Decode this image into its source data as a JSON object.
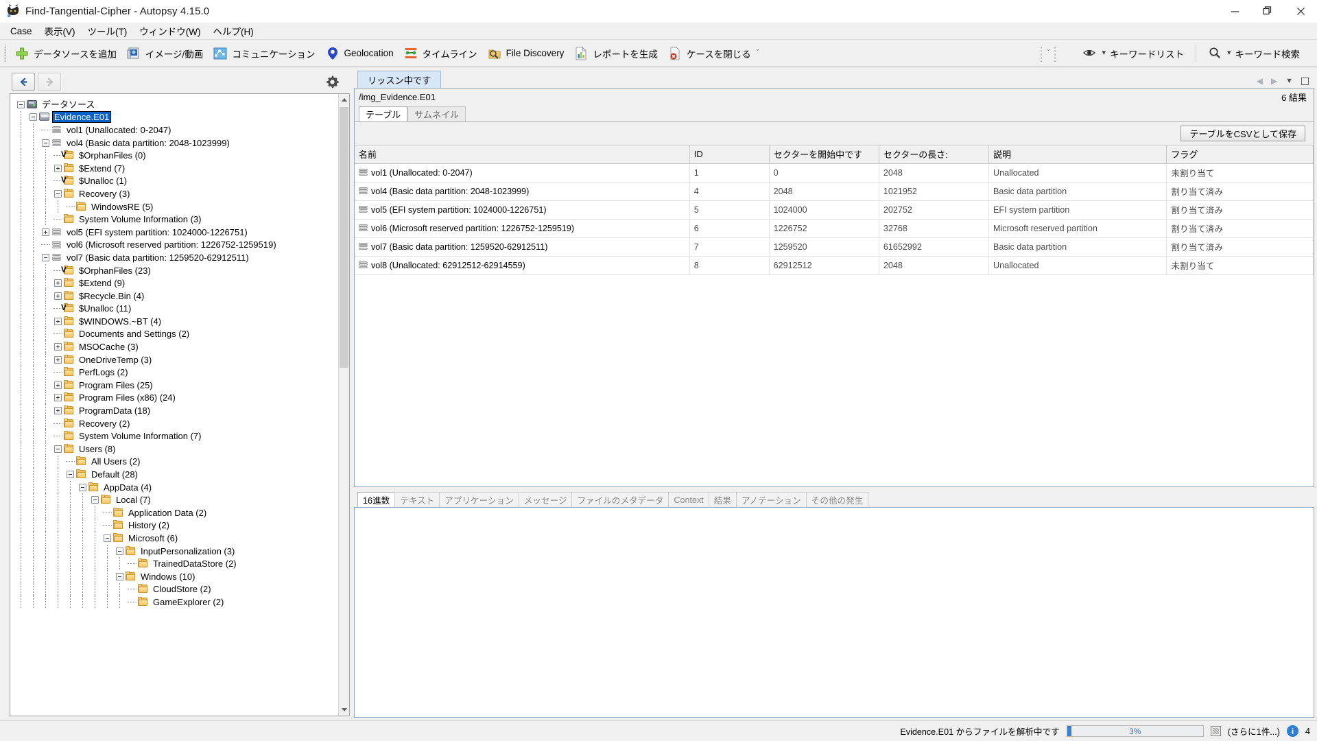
{
  "window": {
    "title": "Find-Tangential-Cipher - Autopsy 4.15.0",
    "app_icon": "autopsy-logo-icon",
    "minimize": "—",
    "maximize": "❐",
    "close": "✕"
  },
  "menubar": {
    "items": [
      {
        "label": "Case"
      },
      {
        "label": "表示(V)"
      },
      {
        "label": "ツール(T)"
      },
      {
        "label": "ウィンドウ(W)"
      },
      {
        "label": "ヘルプ(H)"
      }
    ]
  },
  "toolbar": {
    "buttons": [
      {
        "label": "データソースを追加",
        "icon": "plus-icon"
      },
      {
        "label": "イメージ/動画",
        "icon": "image-video-icon"
      },
      {
        "label": "コミュニケーション",
        "icon": "communications-icon"
      },
      {
        "label": "Geolocation",
        "icon": "map-pin-icon"
      },
      {
        "label": "タイムライン",
        "icon": "timeline-icon"
      },
      {
        "label": "File Discovery",
        "icon": "file-discovery-icon"
      },
      {
        "label": "レポートを生成",
        "icon": "report-icon"
      },
      {
        "label": "ケースを閉じる",
        "icon": "close-case-icon"
      }
    ],
    "overflow_chevron": "ˇ",
    "keyword_list": {
      "label": "キーワードリスト",
      "icon": "eye-icon",
      "chevron": "▾"
    },
    "keyword_search": {
      "label": "キーワード検索",
      "icon": "search-icon",
      "chevron": "▾"
    }
  },
  "tree_panel": {
    "back_button": "←",
    "forward_button": "→",
    "settings_icon": "gear-icon",
    "nodes": [
      {
        "depth": 0,
        "label": "データソース",
        "icon": "datasource-icon",
        "toggle": "minus",
        "selected": false
      },
      {
        "depth": 1,
        "label": "Evidence.E01",
        "icon": "disk-image-icon",
        "toggle": "minus",
        "selected": true
      },
      {
        "depth": 2,
        "label": "vol1 (Unallocated: 0-2047)",
        "icon": "volume-icon",
        "toggle": "none",
        "selected": false
      },
      {
        "depth": 2,
        "label": "vol4 (Basic data partition: 2048-1023999)",
        "icon": "volume-icon",
        "toggle": "minus",
        "selected": false
      },
      {
        "depth": 3,
        "label": "$OrphanFiles (0)",
        "icon": "folder-virtual-icon",
        "toggle": "none",
        "selected": false
      },
      {
        "depth": 3,
        "label": "$Extend (7)",
        "icon": "folder-icon",
        "toggle": "plus",
        "selected": false
      },
      {
        "depth": 3,
        "label": "$Unalloc (1)",
        "icon": "folder-virtual-icon",
        "toggle": "none",
        "selected": false
      },
      {
        "depth": 3,
        "label": "Recovery (3)",
        "icon": "folder-icon",
        "toggle": "minus",
        "selected": false
      },
      {
        "depth": 4,
        "label": "WindowsRE (5)",
        "icon": "folder-icon",
        "toggle": "none",
        "selected": false
      },
      {
        "depth": 3,
        "label": "System Volume Information (3)",
        "icon": "folder-icon",
        "toggle": "none",
        "selected": false
      },
      {
        "depth": 2,
        "label": "vol5 (EFI system partition: 1024000-1226751)",
        "icon": "volume-icon",
        "toggle": "plus",
        "selected": false
      },
      {
        "depth": 2,
        "label": "vol6 (Microsoft reserved partition: 1226752-1259519)",
        "icon": "volume-icon",
        "toggle": "none",
        "selected": false
      },
      {
        "depth": 2,
        "label": "vol7 (Basic data partition: 1259520-62912511)",
        "icon": "volume-icon",
        "toggle": "minus",
        "selected": false
      },
      {
        "depth": 3,
        "label": "$OrphanFiles (23)",
        "icon": "folder-virtual-icon",
        "toggle": "none",
        "selected": false
      },
      {
        "depth": 3,
        "label": "$Extend (9)",
        "icon": "folder-icon",
        "toggle": "plus",
        "selected": false
      },
      {
        "depth": 3,
        "label": "$Recycle.Bin (4)",
        "icon": "folder-icon",
        "toggle": "plus",
        "selected": false
      },
      {
        "depth": 3,
        "label": "$Unalloc (11)",
        "icon": "folder-virtual-icon",
        "toggle": "none",
        "selected": false
      },
      {
        "depth": 3,
        "label": "$WINDOWS.~BT (4)",
        "icon": "folder-icon",
        "toggle": "plus",
        "selected": false
      },
      {
        "depth": 3,
        "label": "Documents and Settings (2)",
        "icon": "folder-icon",
        "toggle": "none",
        "selected": false
      },
      {
        "depth": 3,
        "label": "MSOCache (3)",
        "icon": "folder-icon",
        "toggle": "plus",
        "selected": false
      },
      {
        "depth": 3,
        "label": "OneDriveTemp (3)",
        "icon": "folder-icon",
        "toggle": "plus",
        "selected": false
      },
      {
        "depth": 3,
        "label": "PerfLogs (2)",
        "icon": "folder-icon",
        "toggle": "none",
        "selected": false
      },
      {
        "depth": 3,
        "label": "Program Files (25)",
        "icon": "folder-icon",
        "toggle": "plus",
        "selected": false
      },
      {
        "depth": 3,
        "label": "Program Files (x86) (24)",
        "icon": "folder-icon",
        "toggle": "plus",
        "selected": false
      },
      {
        "depth": 3,
        "label": "ProgramData (18)",
        "icon": "folder-icon",
        "toggle": "plus",
        "selected": false
      },
      {
        "depth": 3,
        "label": "Recovery (2)",
        "icon": "folder-icon",
        "toggle": "none",
        "selected": false
      },
      {
        "depth": 3,
        "label": "System Volume Information (7)",
        "icon": "folder-icon",
        "toggle": "none",
        "selected": false
      },
      {
        "depth": 3,
        "label": "Users (8)",
        "icon": "folder-icon",
        "toggle": "minus",
        "selected": false
      },
      {
        "depth": 4,
        "label": "All Users (2)",
        "icon": "folder-icon",
        "toggle": "none",
        "selected": false
      },
      {
        "depth": 4,
        "label": "Default (28)",
        "icon": "folder-icon",
        "toggle": "minus",
        "selected": false
      },
      {
        "depth": 5,
        "label": "AppData (4)",
        "icon": "folder-icon",
        "toggle": "minus",
        "selected": false
      },
      {
        "depth": 6,
        "label": "Local (7)",
        "icon": "folder-icon",
        "toggle": "minus",
        "selected": false
      },
      {
        "depth": 7,
        "label": "Application Data (2)",
        "icon": "folder-icon",
        "toggle": "none",
        "selected": false
      },
      {
        "depth": 7,
        "label": "History (2)",
        "icon": "folder-icon",
        "toggle": "none",
        "selected": false
      },
      {
        "depth": 7,
        "label": "Microsoft (6)",
        "icon": "folder-icon",
        "toggle": "minus",
        "selected": false
      },
      {
        "depth": 8,
        "label": "InputPersonalization (3)",
        "icon": "folder-icon",
        "toggle": "minus",
        "selected": false
      },
      {
        "depth": 9,
        "label": "TrainedDataStore (2)",
        "icon": "folder-icon",
        "toggle": "none",
        "selected": false
      },
      {
        "depth": 8,
        "label": "Windows (10)",
        "icon": "folder-icon",
        "toggle": "minus",
        "selected": false
      },
      {
        "depth": 9,
        "label": "CloudStore (2)",
        "icon": "folder-icon",
        "toggle": "none",
        "selected": false
      },
      {
        "depth": 9,
        "label": "GameExplorer (2)",
        "icon": "folder-icon",
        "toggle": "none",
        "selected": false
      }
    ]
  },
  "results": {
    "tab_label": "リッスン中です",
    "path": "/img_Evidence.E01",
    "count_label": "6 結果",
    "view_tabs": [
      {
        "label": "テーブル",
        "active": true
      },
      {
        "label": "サムネイル",
        "active": false
      }
    ],
    "save_csv_label": "テーブルをCSVとして保存",
    "panel_controls": {
      "prev": "◀",
      "next": "▶",
      "dropdown": "▼",
      "maximize": "maximize-icon"
    },
    "columns": [
      "名前",
      "ID",
      "セクターを開始中です",
      "セクターの長さ:",
      "説明",
      "フラグ"
    ],
    "rows": [
      [
        "vol1 (Unallocated: 0-2047)",
        "1",
        "0",
        "2048",
        "Unallocated",
        "未割り当て"
      ],
      [
        "vol4 (Basic data partition: 2048-1023999)",
        "4",
        "2048",
        "1021952",
        "Basic data partition",
        "割り当て済み"
      ],
      [
        "vol5 (EFI system partition: 1024000-1226751)",
        "5",
        "1024000",
        "202752",
        "EFI system partition",
        "割り当て済み"
      ],
      [
        "vol6 (Microsoft reserved partition: 1226752-1259519)",
        "6",
        "1226752",
        "32768",
        "Microsoft reserved partition",
        "割り当て済み"
      ],
      [
        "vol7 (Basic data partition: 1259520-62912511)",
        "7",
        "1259520",
        "61652992",
        "Basic data partition",
        "割り当て済み"
      ],
      [
        "vol8 (Unallocated: 62912512-62914559)",
        "8",
        "62912512",
        "2048",
        "Unallocated",
        "未割り当て"
      ]
    ]
  },
  "viewer": {
    "tabs": [
      {
        "label": "16進数",
        "active": true
      },
      {
        "label": "テキスト",
        "active": false
      },
      {
        "label": "アプリケーション",
        "active": false
      },
      {
        "label": "メッセージ",
        "active": false
      },
      {
        "label": "ファイルのメタデータ",
        "active": false
      },
      {
        "label": "Context",
        "active": false
      },
      {
        "label": "結果",
        "active": false
      },
      {
        "label": "アノテーション",
        "active": false
      },
      {
        "label": "その他の発生",
        "active": false
      }
    ]
  },
  "statusbar": {
    "message": "Evidence.E01 からファイルを解析中です",
    "progress_pct": "3%",
    "progress_value": 3,
    "more_label": "(さらに1件...)",
    "notification_count": "4"
  },
  "colors": {
    "accent": "#0a62c8",
    "progress": "#3f7fd0",
    "tab_active": "#d7e7f7",
    "selection": "#0a62c8"
  }
}
